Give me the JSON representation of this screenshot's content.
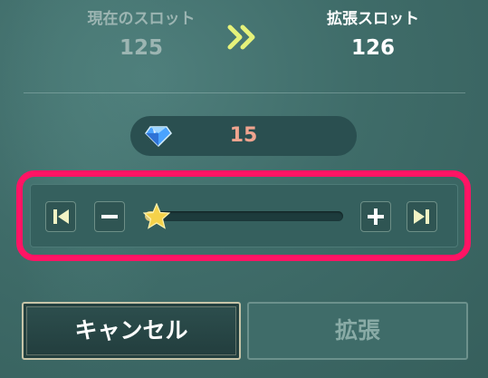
{
  "current_slot": {
    "label": "現在のスロット",
    "value": "125"
  },
  "expanded_slot": {
    "label": "拡張スロット",
    "value": "126"
  },
  "cost": {
    "icon": "gem-icon",
    "value": "15"
  },
  "slider": {
    "level": 0.06
  },
  "buttons": {
    "cancel_label": "キャンセル",
    "expand_label": "拡張"
  },
  "colors": {
    "highlight": "#ff1464",
    "cost_text": "#f0a48f",
    "star": "#f5d24a"
  }
}
